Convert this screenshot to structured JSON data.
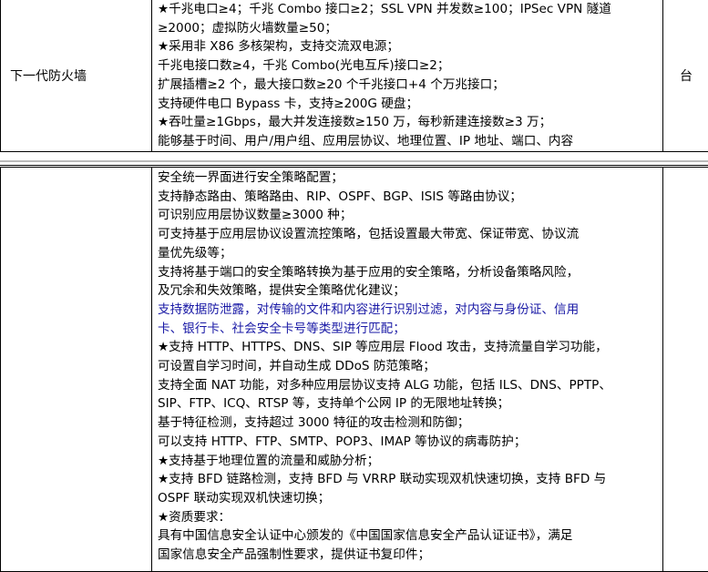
{
  "table1": {
    "row_label": "下一代防火墙",
    "unit": "台",
    "lines": [
      "★千兆电口≥4；千兆 Combo 接口≥2；SSL VPN 并发数≥100；IPSec VPN 隧道",
      "≥2000；虚拟防火墙数量≥50；",
      "★采用非 X86 多核架构，支持交流双电源；",
      "千兆电接口数≥4，千兆 Combo(光电互斥)接口≥2；",
      "扩展插槽≥2 个，最大接口数≥20 个千兆接口+4 个万兆接口；",
      "支持硬件电口 Bypass 卡，支持≥200G 硬盘；",
      "★吞吐量≥1Gbps，最大并发连接数≥150 万，每秒新建连接数≥3 万；",
      "能够基于时间、用户/用户组、应用层协议、地理位置、IP 地址、端口、内容"
    ]
  },
  "table2": {
    "lines": [
      "安全统一界面进行安全策略配置；",
      "支持静态路由、策略路由、RIP、OSPF、BGP、ISIS 等路由协议；",
      "可识别应用层协议数量≥3000 种；",
      "可支持基于应用层协议设置流控策略，包括设置最大带宽、保证带宽、协议流",
      "量优先级等；",
      "支持将基于端口的安全策略转换为基于应用的安全策略，分析设备策略风险，",
      "及冗余和失效策略，提供安全策略优化建议；",
      "支持数据防泄露，对传输的文件和内容进行识别过滤，对内容与身份证、信用",
      "卡、银行卡、社会安全卡号等类型进行匹配；",
      "★支持 HTTP、HTTPS、DNS、SIP 等应用层 Flood 攻击，支持流量自学习功能，",
      "可设置自学习时间，并自动生成 DDoS 防范策略；",
      "支持全面 NAT 功能，对多种应用层协议支持 ALG 功能，包括 ILS、DNS、PPTP、",
      "SIP、FTP、ICQ、RTSP 等，支持单个公网 IP 的无限地址转换；",
      "基于特征检测，支持超过 3000 特征的攻击检测和防御；",
      "可以支持 HTTP、FTP、SMTP、POP3、IMAP 等协议的病毒防护；",
      "★支持基于地理位置的流量和威胁分析；",
      "★支持 BFD 链路检测，支持 BFD 与 VRRP 联动实现双机快速切换，支持 BFD 与",
      "OSPF 联动实现双机快速切换；",
      "★资质要求：",
      "具有中国信息安全认证中心颁发的《中国国家信息安全产品认证证书》，满足",
      "国家信息安全产品强制性要求，提供证书复印件；"
    ]
  }
}
